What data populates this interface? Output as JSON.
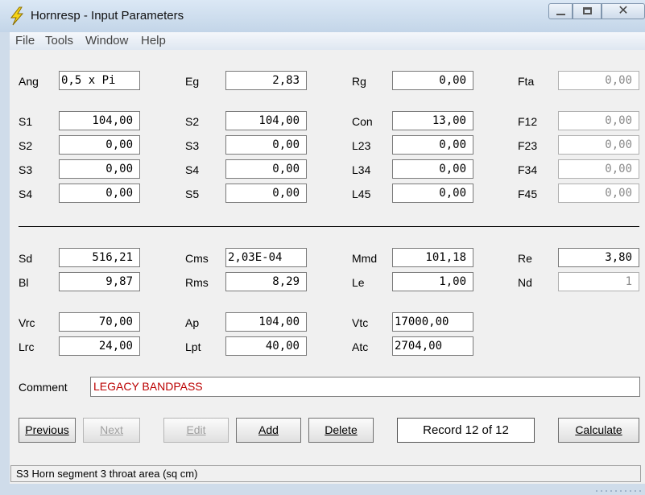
{
  "window": {
    "title": "Hornresp - Input Parameters"
  },
  "menu": [
    "File",
    "Tools",
    "Window",
    "Help"
  ],
  "params": [
    {
      "label": "Ang",
      "value": "0,5 x Pi"
    },
    {
      "label": "Eg",
      "value": "2,83"
    },
    {
      "label": "Rg",
      "value": "0,00"
    },
    {
      "label": "Fta",
      "value": "0,00"
    },
    {
      "label": "S1",
      "value": "104,00"
    },
    {
      "label": "S2",
      "value": "104,00"
    },
    {
      "label": "Con",
      "value": "13,00"
    },
    {
      "label": "F12",
      "value": "0,00"
    },
    {
      "label": "S2",
      "value": "0,00"
    },
    {
      "label": "S3",
      "value": "0,00"
    },
    {
      "label": "L23",
      "value": "0,00"
    },
    {
      "label": "F23",
      "value": "0,00"
    },
    {
      "label": "S3",
      "value": "0,00"
    },
    {
      "label": "S4",
      "value": "0,00"
    },
    {
      "label": "L34",
      "value": "0,00"
    },
    {
      "label": "F34",
      "value": "0,00"
    },
    {
      "label": "S4",
      "value": "0,00"
    },
    {
      "label": "S5",
      "value": "0,00"
    },
    {
      "label": "L45",
      "value": "0,00"
    },
    {
      "label": "F45",
      "value": "0,00"
    },
    {
      "label": "Sd",
      "value": "516,21"
    },
    {
      "label": "Cms",
      "value": "2,03E-04"
    },
    {
      "label": "Mmd",
      "value": "101,18"
    },
    {
      "label": "Re",
      "value": "3,80"
    },
    {
      "label": "Bl",
      "value": "9,87"
    },
    {
      "label": "Rms",
      "value": "8,29"
    },
    {
      "label": "Le",
      "value": "1,00"
    },
    {
      "label": "Nd",
      "value": "1"
    },
    {
      "label": "Vrc",
      "value": "70,00"
    },
    {
      "label": "Ap",
      "value": "104,00"
    },
    {
      "label": "Vtc",
      "value": "17000,00"
    },
    {
      "label": "Lrc",
      "value": "24,00"
    },
    {
      "label": "Lpt",
      "value": "40,00"
    },
    {
      "label": "Atc",
      "value": "2704,00"
    }
  ],
  "comment": {
    "label": "Comment",
    "value": "LEGACY BANDPASS"
  },
  "buttons": {
    "previous": "Previous",
    "next": "Next",
    "edit": "Edit",
    "add": "Add",
    "delete": "Delete",
    "calculate": "Calculate"
  },
  "record": "Record 12 of 12",
  "status": "S3   Horn segment 3 throat area  (sq cm)",
  "colors": {
    "comment_text": "#bb0000",
    "title_bar": "#c3d5e8",
    "client_bg": "#f0f0f0"
  }
}
